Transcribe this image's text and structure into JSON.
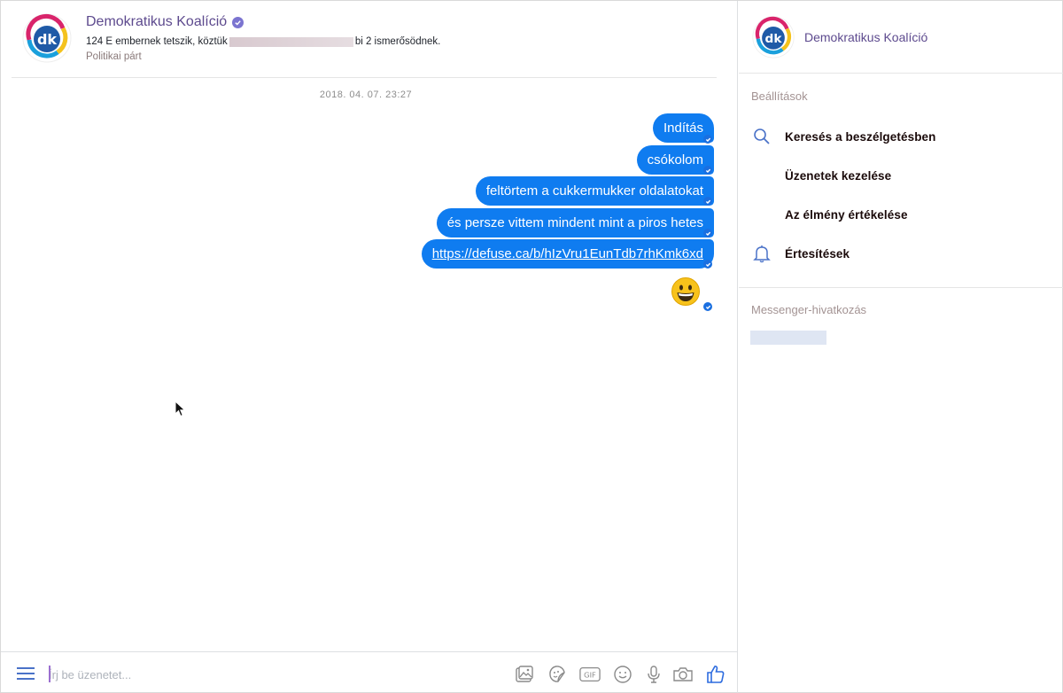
{
  "conversation": {
    "page_name": "Demokratikus Koalíció",
    "likes_prefix": "124 E embernek tetszik, köztük",
    "likes_suffix": "bi 2 ismerősödnek.",
    "category": "Politikai párt",
    "timestamp": "2018. 04. 07. 23:27",
    "logo_text": "dk",
    "messages": [
      {
        "text": "Indítás"
      },
      {
        "text": "csókolom"
      },
      {
        "text": "feltörtem a cukkermukker oldalatokat"
      },
      {
        "text": "és persze vittem mindent mint a piros hetes"
      },
      {
        "text": "https://defuse.ca/b/hIzVru1EunTdb7rhKmk6xd"
      }
    ],
    "emoji_message": "grinning-face-emoji"
  },
  "composer": {
    "placeholder": "Írj be üzenetet...",
    "tools": [
      "image-icon",
      "sticker-icon",
      "gif-icon",
      "emoji-icon",
      "microphone-icon",
      "camera-icon",
      "thumbs-up-icon"
    ],
    "gif_label": "GIF"
  },
  "info_panel": {
    "page_name": "Demokratikus Koalíció",
    "settings_title": "Beállítások",
    "options": [
      {
        "label": "Keresés a beszélgetésben",
        "icon": "search-icon"
      },
      {
        "label": "Üzenetek kezelése",
        "icon": ""
      },
      {
        "label": "Az élmény értékelése",
        "icon": ""
      },
      {
        "label": "Értesítések",
        "icon": "bell-icon"
      }
    ],
    "link_title": "Messenger-hivatkozás"
  },
  "colors": {
    "bubble": "#0f7cf0",
    "accent": "#5d4a8e",
    "icon": "#4a72c8"
  }
}
